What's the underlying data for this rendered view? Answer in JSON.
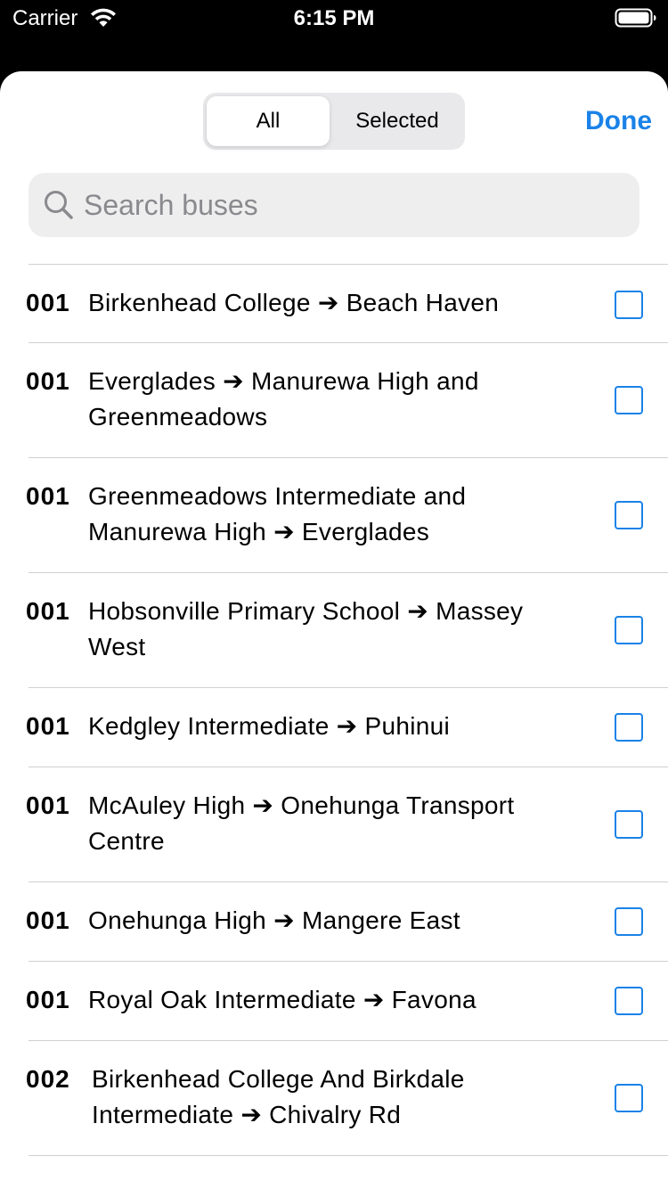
{
  "status_bar": {
    "carrier": "Carrier",
    "time": "6:15 PM"
  },
  "header": {
    "segments": [
      "All",
      "Selected"
    ],
    "selected_segment": "All",
    "done_label": "Done",
    "accent_color": "#1a82e8"
  },
  "search": {
    "placeholder": "Search buses",
    "value": ""
  },
  "routes": [
    {
      "number": "001",
      "name": "Birkenhead College ➔ Beach Haven",
      "checked": false
    },
    {
      "number": "001",
      "name": "Everglades ➔ Manurewa High and Greenmeadows",
      "checked": false
    },
    {
      "number": "001",
      "name": "Greenmeadows Intermediate and Manurewa High ➔ Everglades",
      "checked": false
    },
    {
      "number": "001",
      "name": "Hobsonville Primary School ➔ Massey West",
      "checked": false
    },
    {
      "number": "001",
      "name": "Kedgley Intermediate ➔ Puhinui",
      "checked": false
    },
    {
      "number": "001",
      "name": "McAuley High ➔ Onehunga Transport Centre",
      "checked": false
    },
    {
      "number": "001",
      "name": "Onehunga High ➔ Mangere East",
      "checked": false
    },
    {
      "number": "001",
      "name": "Royal Oak Intermediate ➔ Favona",
      "checked": false
    },
    {
      "number": "002",
      "name": "Birkenhead College And Birkdale Intermediate ➔ Chivalry Rd",
      "checked": false
    }
  ]
}
